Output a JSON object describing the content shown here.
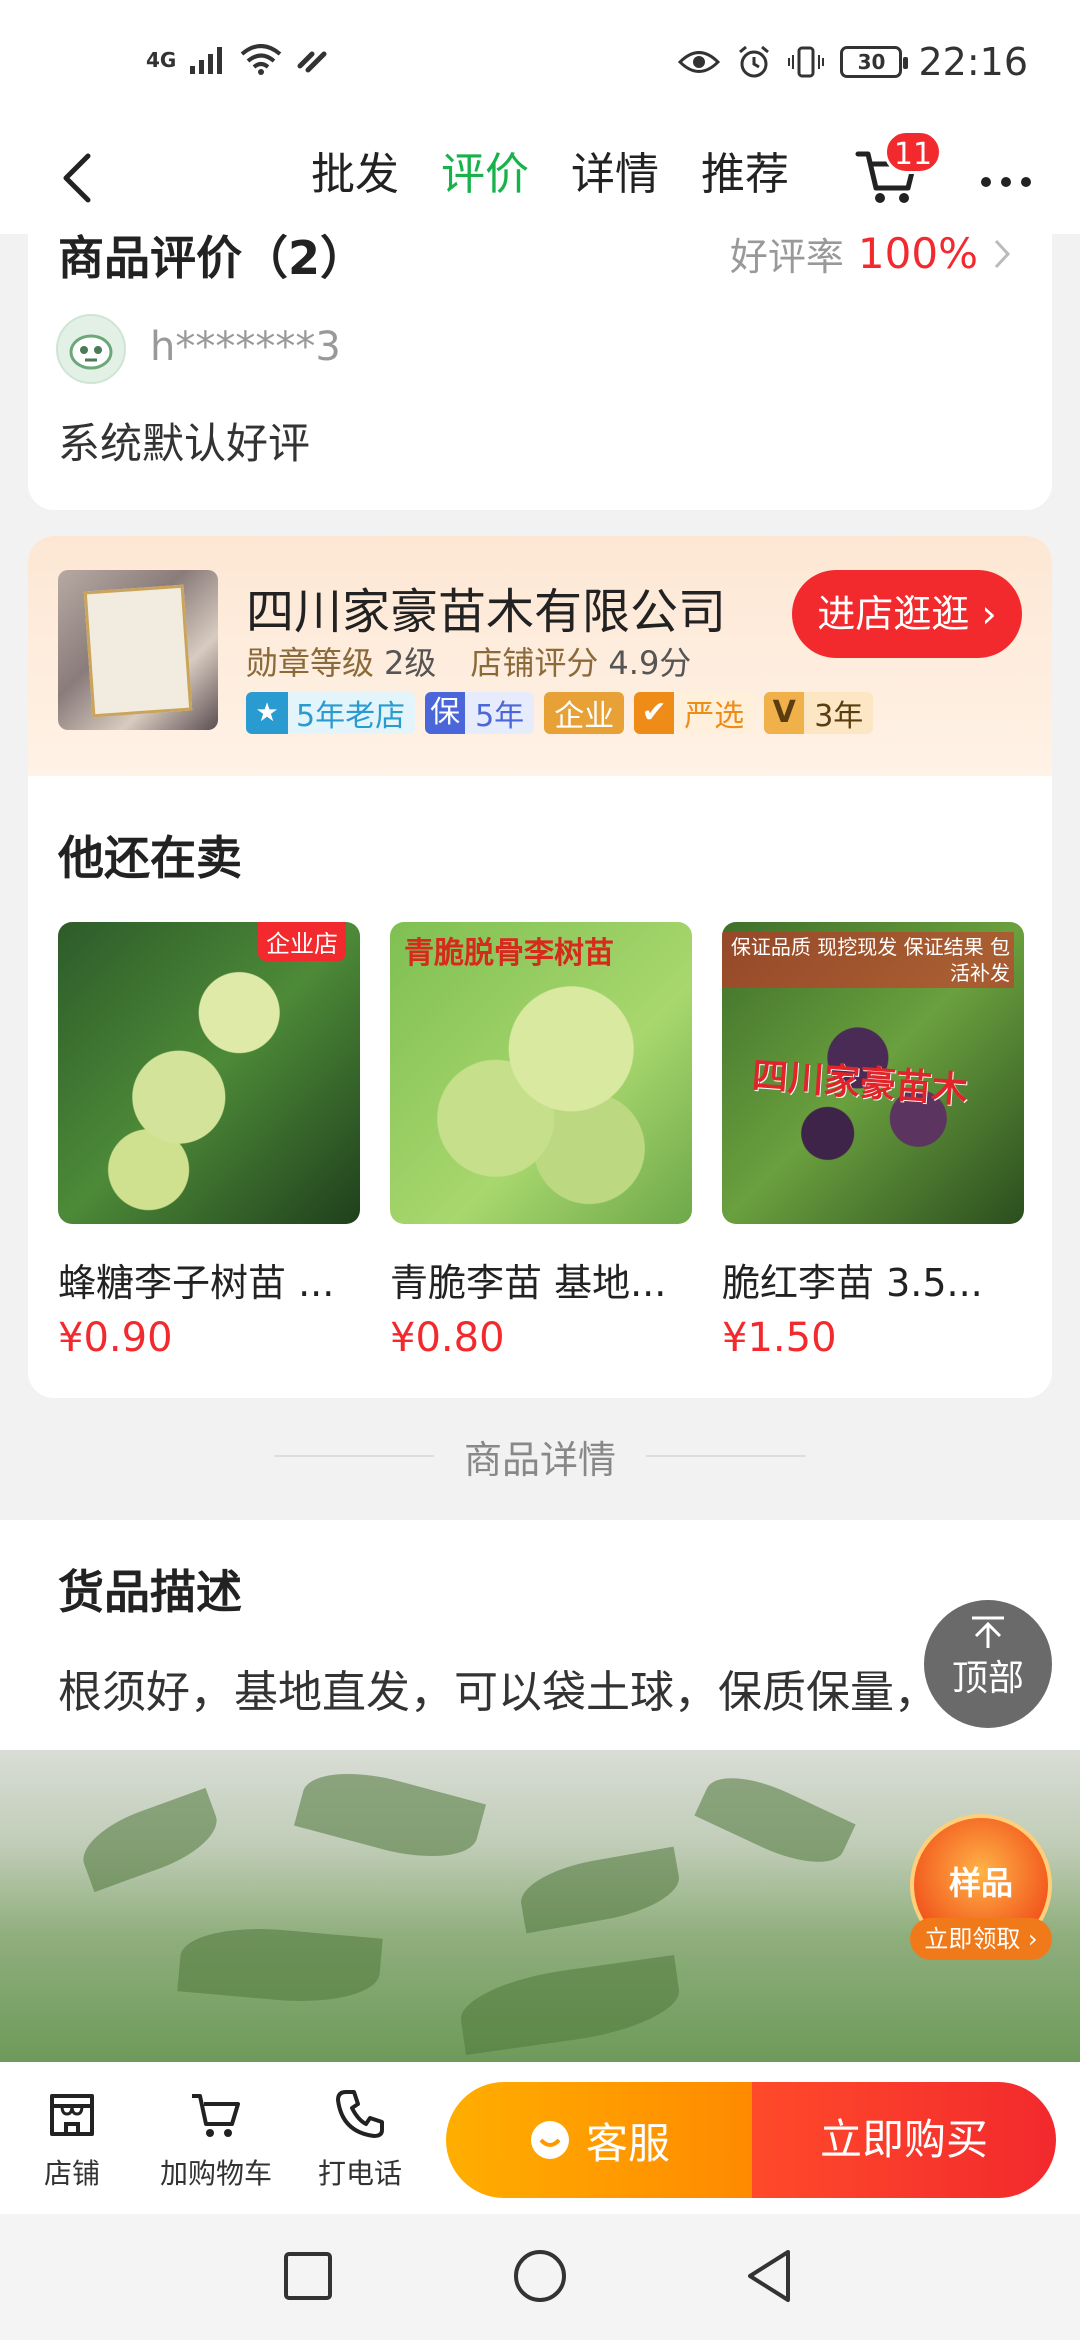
{
  "status_bar": {
    "network": "4G",
    "time": "22:16",
    "battery": "30"
  },
  "nav": {
    "tabs": [
      {
        "label": "批发",
        "active": false
      },
      {
        "label": "评价",
        "active": true
      },
      {
        "label": "详情",
        "active": false
      },
      {
        "label": "推荐",
        "active": false
      }
    ],
    "cart_badge": "11",
    "accent_color": "#18b24b"
  },
  "review": {
    "title": "商品评价（2）",
    "rate_label": "好评率",
    "rate_value": "100%",
    "user": "h*******3",
    "text": "系统默认好评"
  },
  "shop": {
    "name": "四川家豪苗木有限公司",
    "medal_label": "勋章等级",
    "medal_value": "2级",
    "score_label": "店铺评分",
    "score_value": "4.9分",
    "enter_label": "进店逛逛",
    "badges": {
      "old_store": "5年老店",
      "bao_icon": "保",
      "bao_years": "5年",
      "enterprise": "企业",
      "yanxuan": "严选",
      "v_icon": "V",
      "v_years": "3年"
    }
  },
  "also_selling": {
    "title": "他还在卖",
    "products": [
      {
        "name": "蜂糖李子树苗 ...",
        "price": "¥0.90",
        "tag": "企业店"
      },
      {
        "name": "青脆李苗 基地...",
        "price": "¥0.80",
        "overlay": "青脆脱骨李树苗"
      },
      {
        "name": "脆红李苗 3.5...",
        "price": "¥1.50",
        "overlay": "四川家豪苗木",
        "side_text": "保证品质 现挖现发 保证结果 包活补发"
      }
    ]
  },
  "detail": {
    "divider": "商品详情",
    "desc_title": "货品描述",
    "desc_text": "根须好，基地直发，可以袋土球，保质保量，"
  },
  "floating": {
    "to_top": "顶部",
    "sample": "样品",
    "sample_sub": "立即领取"
  },
  "bottom_bar": {
    "shop": "店铺",
    "add_cart": "加购物车",
    "call": "打电话",
    "service": "客服",
    "buy": "立即购买"
  }
}
